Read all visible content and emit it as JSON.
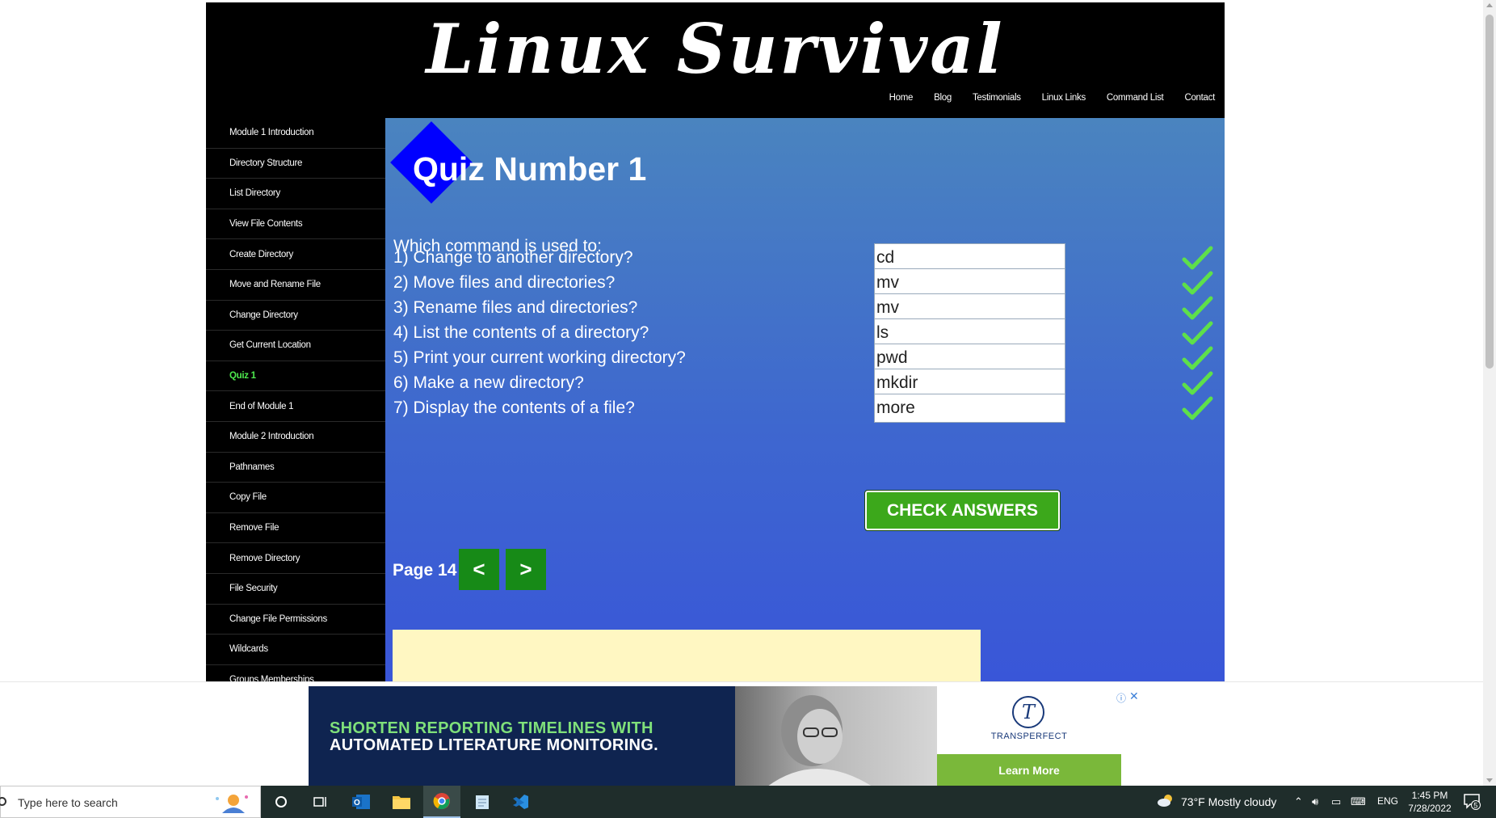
{
  "site": {
    "title": "Linux Survival",
    "nav": [
      "Home",
      "Blog",
      "Testimonials",
      "Linux Links",
      "Command List",
      "Contact"
    ]
  },
  "sidebar": {
    "items": [
      "Module 1 Introduction",
      "Directory Structure",
      "List Directory",
      "View File Contents",
      "Create Directory",
      "Move and Rename File",
      "Change Directory",
      "Get Current Location",
      "Quiz 1",
      "End of Module 1",
      "Module 2 Introduction",
      "Pathnames",
      "Copy File",
      "Remove File",
      "Remove Directory",
      "File Security",
      "Change File Permissions",
      "Wildcards",
      "Groups Memberships"
    ],
    "active_index": 8
  },
  "quiz": {
    "title": "Quiz Number 1",
    "prompt": "Which command is used to:",
    "questions": [
      {
        "text": "1) Change to another directory?",
        "answer": "cd",
        "correct": true
      },
      {
        "text": "2) Move files and directories?",
        "answer": "mv",
        "correct": true
      },
      {
        "text": "3) Rename files and directories?",
        "answer": "mv",
        "correct": true
      },
      {
        "text": "4) List the contents of a directory?",
        "answer": "ls",
        "correct": true
      },
      {
        "text": "5) Print your current working directory?",
        "answer": "pwd",
        "correct": true
      },
      {
        "text": "6) Make a new directory?",
        "answer": "mkdir",
        "correct": true
      },
      {
        "text": "7) Display the contents of a file?",
        "answer": "more",
        "correct": true
      }
    ],
    "check_button": "CHECK ANSWERS",
    "page_label": "Page 14",
    "prev_label": "<",
    "next_label": ">"
  },
  "ad": {
    "headline_line1": "SHORTEN REPORTING TIMELINES WITH",
    "headline_line2": "AUTOMATED LITERATURE MONITORING.",
    "brand": "TRANSPERFECT",
    "cta": "Learn More",
    "info_icon": "ⓘ",
    "close_icon": "✕"
  },
  "taskbar": {
    "search_placeholder": "Type here to search",
    "weather": "73°F  Mostly cloudy",
    "language": "ENG",
    "time": "1:45 PM",
    "date": "7/28/2022",
    "notification_count": "5"
  },
  "colors": {
    "check_green": "#5ee04a",
    "button_green": "#3ca81b",
    "nav_green": "#178a17",
    "active_sidebar": "#4eea4e",
    "diamond_blue": "#0000ff"
  }
}
